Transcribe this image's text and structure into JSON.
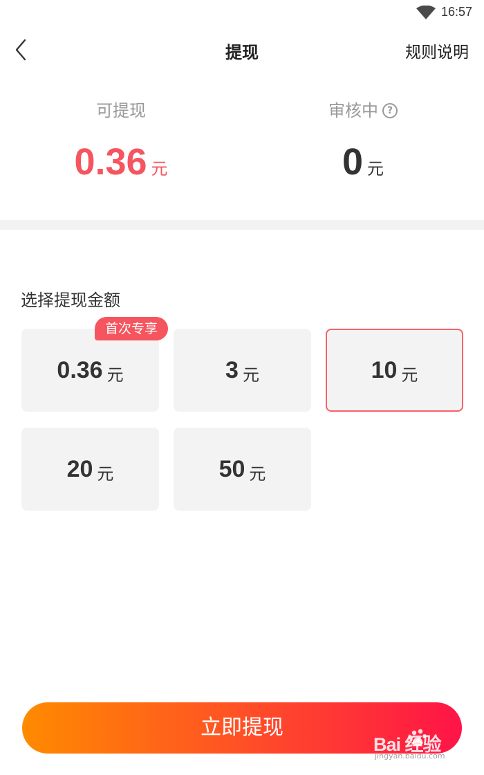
{
  "status_bar": {
    "time": "16:57",
    "icon": "wifi-icon"
  },
  "nav": {
    "title": "提现",
    "rules_label": "规则说明",
    "back_icon": "back-arrow-icon"
  },
  "summary": {
    "available": {
      "label": "可提现",
      "amount": "0.36",
      "unit": "元"
    },
    "pending": {
      "label": "审核中",
      "help_symbol": "?",
      "amount": "0",
      "unit": "元"
    }
  },
  "selection": {
    "title": "选择提现金额",
    "badge": "首次专享",
    "unit": "元",
    "options": [
      {
        "value": "0.36",
        "selected": false
      },
      {
        "value": "3",
        "selected": false
      },
      {
        "value": "10",
        "selected": true
      },
      {
        "value": "20",
        "selected": false
      },
      {
        "value": "50",
        "selected": false
      }
    ]
  },
  "action": {
    "withdraw_label": "立即提现"
  },
  "watermark": {
    "brand": "Bai  经验",
    "sub": "jingyan.baidu.com"
  },
  "colors": {
    "accent_red": "#f5555f",
    "button_gradient_start": "#ff8a00",
    "button_gradient_end": "#ff1447",
    "option_bg": "#f3f3f3",
    "divider": "#f2f2f2"
  }
}
